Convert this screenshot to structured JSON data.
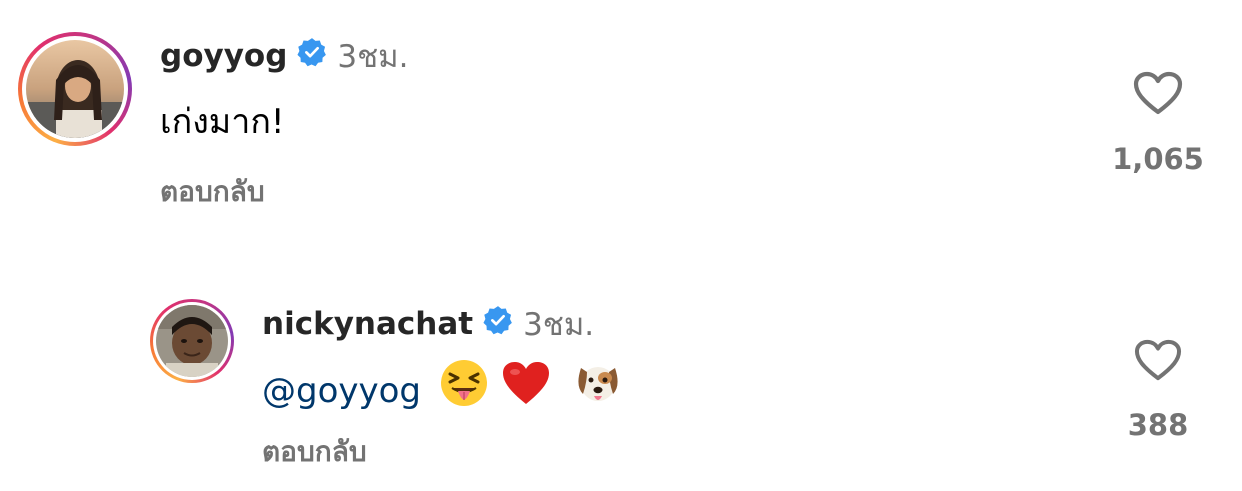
{
  "comments": [
    {
      "username": "goyyog",
      "verified": true,
      "time": "3ชม.",
      "text": "เก่งมาก!",
      "reply_label": "ตอบกลับ",
      "like_count": "1,065",
      "like_icon": "heart-outline-icon"
    },
    {
      "username": "nickynachat",
      "verified": true,
      "time": "3ชม.",
      "mention": "@goyyog",
      "emojis": [
        "squinting-face-with-tongue-icon",
        "red-heart-icon",
        "dog-face-icon"
      ],
      "reply_label": "ตอบกลับ",
      "like_count": "388",
      "like_icon": "heart-outline-icon"
    }
  ],
  "colors": {
    "text": "#262626",
    "secondary": "#737373",
    "verified_blue": "#3897f0",
    "mention": "#00376b",
    "heart": "#737373"
  }
}
